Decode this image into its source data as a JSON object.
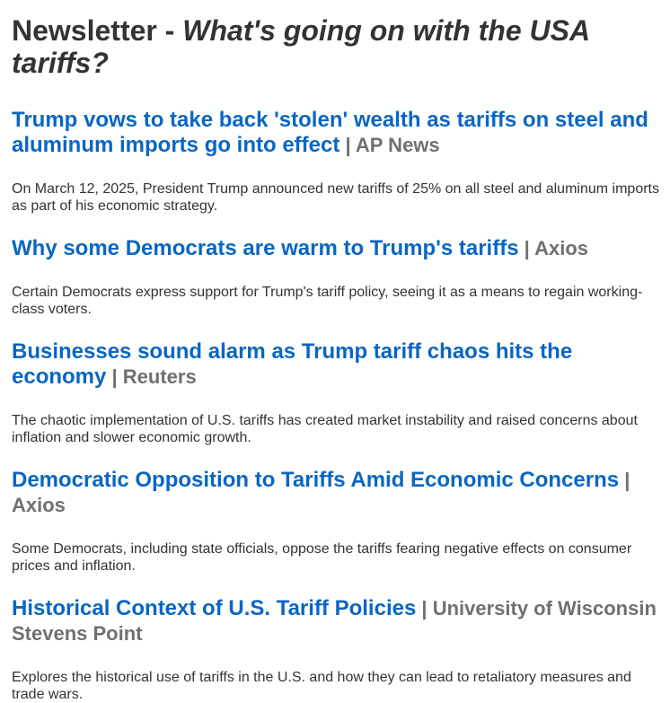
{
  "newsletter": {
    "title_prefix": "Newsletter - ",
    "title_emphasis": "What's going on with the USA tariffs?"
  },
  "articles": [
    {
      "headline": "Trump vows to take back 'stolen' wealth as tariffs on steel and aluminum imports go into effect",
      "source": " | AP News",
      "summary": "On March 12, 2025, President Trump announced new tariffs of 25% on all steel and aluminum imports as part of his economic strategy."
    },
    {
      "headline": "Why some Democrats are warm to Trump's tariffs",
      "source": " | Axios",
      "summary": "Certain Democrats express support for Trump's tariff policy, seeing it as a means to regain working-class voters."
    },
    {
      "headline": "Businesses sound alarm as Trump tariff chaos hits the economy",
      "source": " | Reuters",
      "summary": "The chaotic implementation of U.S. tariffs has created market instability and raised concerns about inflation and slower economic growth."
    },
    {
      "headline": "Democratic Opposition to Tariffs Amid Economic Concerns",
      "source": " | Axios",
      "summary": "Some Democrats, including state officials, oppose the tariffs fearing negative effects on consumer prices and inflation."
    },
    {
      "headline": "Historical Context of U.S. Tariff Policies",
      "source": " | University of Wisconsin Stevens Point",
      "summary": "Explores the historical use of tariffs in the U.S. and how they can lead to retaliatory measures and trade wars."
    }
  ]
}
